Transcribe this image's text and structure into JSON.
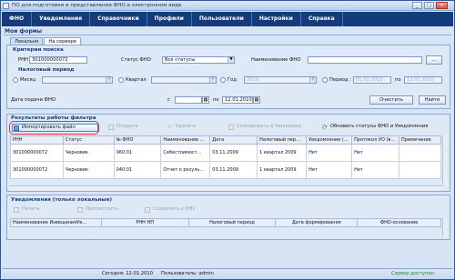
{
  "window": {
    "title": "ПО для подготовки и представления ФНО в электронном виде",
    "buttons": [
      "_",
      "□",
      "✕"
    ]
  },
  "menu": [
    "ФНО",
    "Уведомления",
    "Справочники",
    "Профили",
    "Пользователи",
    "Настройки",
    "Справка"
  ],
  "form": {
    "title": "Мои формы",
    "tabs": [
      "Локально",
      "На сервере"
    ],
    "criteria_title": "Критерии поиска",
    "rnn_label": "РНН",
    "rnn_value": "301000000072",
    "status_label": "Статус ФНО",
    "status_value": "Все статусы",
    "name_label": "Наименование ФНО",
    "name_value": "",
    "browse_label": "...",
    "tax_period_title": "Налоговый период",
    "month_label": "Месяц",
    "quarter_label": "Квартал",
    "year_label": "Год",
    "year_value": "2010",
    "period_label": "Период :",
    "period_from": "01.01.2010",
    "period_to": "12.01.2010",
    "period_to_prefix": "по",
    "submit_date_label": "Дата подачи ФНО",
    "date_from_prefix": "с",
    "date_from": "",
    "date_to_prefix": "по",
    "date_to": "12.01.2010",
    "clear_button": "Очистить",
    "find_button": "Найти"
  },
  "results": {
    "title": "Результаты работы фильтра",
    "toolbar": {
      "import": "Импортировать файл",
      "open": "Открыть",
      "delete": "Удалить",
      "copy": "Скопировать в Черновики",
      "refresh": "Обновить статусы ФНО и Уведомления"
    },
    "columns": [
      "РНН",
      "Статус",
      "№ ФНО",
      "Наименование ...",
      "Дата",
      "Налоговый пер...",
      "Уведомление (...",
      "Протокол УО (в...",
      "Примечание"
    ],
    "rows": [
      [
        "301000000072",
        "Черновик",
        "060.01",
        "Себестоимост...",
        "03.11.2009",
        "1 квартал 2009",
        "Нет",
        "Нет",
        ""
      ],
      [
        "301000000072",
        "Черновик",
        "040.01",
        "Отчет о резуль...",
        "03.11.2009",
        "1 квартал 2009",
        "Нет",
        "Нет",
        ""
      ]
    ]
  },
  "notifications": {
    "title": "Уведомления (только локальные)",
    "toolbar": {
      "print": "Печать",
      "preview": "Просмотреть",
      "save_xml": "Сохранить в XML"
    },
    "columns": [
      "Наименование ИзвещенияУв...",
      "РНН НП",
      "Налоговый период",
      "Дата формирования",
      "ФНО-основание"
    ]
  },
  "status": {
    "today": "Сегодня: 12.01.2010",
    "user": "Пользователь: admin",
    "server": "Сервер доступен"
  }
}
